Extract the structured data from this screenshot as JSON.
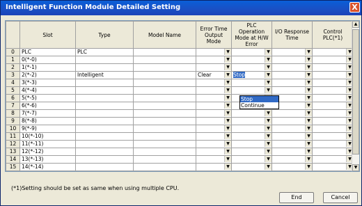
{
  "window": {
    "title": "Intelligent Function Module Detailed Setting",
    "close_glyph": "X"
  },
  "headers": [
    "",
    "Slot",
    "Type",
    "Model Name",
    "Error Time Output Mode",
    "PLC Operation Mode at H/W Error",
    "I/O Response Time",
    "Control PLC(*1)"
  ],
  "rows": [
    {
      "num": "0",
      "slot": "PLC",
      "type": "PLC",
      "model": "",
      "err": "",
      "plc": "",
      "io": "",
      "ctrl": ""
    },
    {
      "num": "1",
      "slot": "0(*-0)",
      "type": "",
      "model": "",
      "err": "",
      "plc": "",
      "io": "",
      "ctrl": ""
    },
    {
      "num": "2",
      "slot": "1(*-1)",
      "type": "",
      "model": "",
      "err": "",
      "plc": "",
      "io": "",
      "ctrl": ""
    },
    {
      "num": "3",
      "slot": "2(*-2)",
      "type": "Intelligent",
      "model": "",
      "err": "Clear",
      "plc": "Stop",
      "io": "",
      "ctrl": ""
    },
    {
      "num": "4",
      "slot": "3(*-3)",
      "type": "",
      "model": "",
      "err": "",
      "plc": "",
      "io": "",
      "ctrl": ""
    },
    {
      "num": "5",
      "slot": "4(*-4)",
      "type": "",
      "model": "",
      "err": "",
      "plc": "",
      "io": "",
      "ctrl": ""
    },
    {
      "num": "6",
      "slot": "5(*-5)",
      "type": "",
      "model": "",
      "err": "",
      "plc": "",
      "io": "",
      "ctrl": ""
    },
    {
      "num": "7",
      "slot": "6(*-6)",
      "type": "",
      "model": "",
      "err": "",
      "plc": "",
      "io": "",
      "ctrl": ""
    },
    {
      "num": "8",
      "slot": "7(*-7)",
      "type": "",
      "model": "",
      "err": "",
      "plc": "",
      "io": "",
      "ctrl": ""
    },
    {
      "num": "9",
      "slot": "8(*-8)",
      "type": "",
      "model": "",
      "err": "",
      "plc": "",
      "io": "",
      "ctrl": ""
    },
    {
      "num": "10",
      "slot": "9(*-9)",
      "type": "",
      "model": "",
      "err": "",
      "plc": "",
      "io": "",
      "ctrl": ""
    },
    {
      "num": "11",
      "slot": "10(*-10)",
      "type": "",
      "model": "",
      "err": "",
      "plc": "",
      "io": "",
      "ctrl": ""
    },
    {
      "num": "12",
      "slot": "11(*-11)",
      "type": "",
      "model": "",
      "err": "",
      "plc": "",
      "io": "",
      "ctrl": ""
    },
    {
      "num": "13",
      "slot": "12(*-12)",
      "type": "",
      "model": "",
      "err": "",
      "plc": "",
      "io": "",
      "ctrl": ""
    },
    {
      "num": "14",
      "slot": "13(*-13)",
      "type": "",
      "model": "",
      "err": "",
      "plc": "",
      "io": "",
      "ctrl": ""
    },
    {
      "num": "15",
      "slot": "14(*-14)",
      "type": "",
      "model": "",
      "err": "",
      "plc": "",
      "io": "",
      "ctrl": ""
    }
  ],
  "dropdown_open": {
    "options": [
      "Stop",
      "Continue"
    ],
    "highlighted": "Stop"
  },
  "footnote": "(*1)Setting should be set as same when using multiple CPU.",
  "buttons": {
    "end": "End",
    "cancel": "Cancel"
  },
  "colors": {
    "titlebar": "#0a5fd8",
    "selection": "#316ac5",
    "dialog_bg": "#ece9d8"
  }
}
